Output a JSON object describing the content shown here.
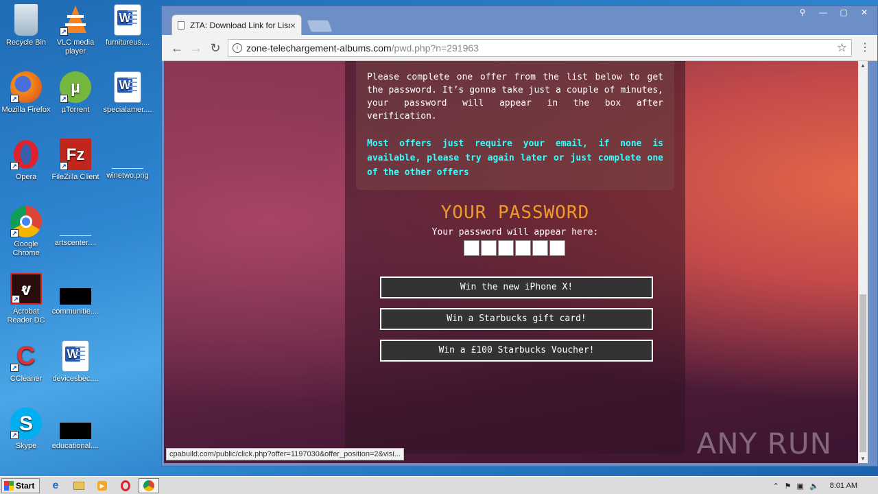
{
  "desktop": {
    "icons": [
      {
        "label": "Recycle Bin",
        "icon": "recycle-bin-icon"
      },
      {
        "label": "VLC media player",
        "icon": "vlc-icon"
      },
      {
        "label": "furnitureus....",
        "icon": "word-doc-icon"
      },
      {
        "label": "Mozilla Firefox",
        "icon": "firefox-icon"
      },
      {
        "label": "µTorrent",
        "icon": "utorrent-icon"
      },
      {
        "label": "specialamer....",
        "icon": "word-doc-icon"
      },
      {
        "label": "Opera",
        "icon": "opera-icon"
      },
      {
        "label": "FileZilla Client",
        "icon": "filezilla-icon"
      },
      {
        "label": "winetwo.png",
        "icon": "image-file-icon"
      },
      {
        "label": "Google Chrome",
        "icon": "chrome-icon"
      },
      {
        "label": "artscenter....",
        "icon": "image-file-icon"
      },
      {
        "label": "Acrobat Reader DC",
        "icon": "acrobat-icon"
      },
      {
        "label": "communitie....",
        "icon": "image-file-icon"
      },
      {
        "label": "CCleaner",
        "icon": "ccleaner-icon"
      },
      {
        "label": "devicesbec....",
        "icon": "word-doc-icon"
      },
      {
        "label": "Skype",
        "icon": "skype-icon"
      },
      {
        "label": "educational....",
        "icon": "image-file-icon"
      }
    ]
  },
  "browser": {
    "tab_title": "ZTA: Download Link for Lisa",
    "url_host": "zone-telechargement-albums.com",
    "url_path": "/pwd.php?n=291963",
    "status_url": "cpabuild.com/public/click.php?offer=1197030&offer_position=2&visi..."
  },
  "page": {
    "intro": "Please complete one offer from the list below to get the password. It’s gonna take just a couple of minutes, your password will appear in the box after verification.",
    "notice": "Most offers just require your email, if none is available, please try again later or just complete one of the other offers",
    "password_title": "YOUR PASSWORD",
    "password_sub": "Your password will appear here:",
    "offers": [
      "Win the new iPhone X!",
      "Win a Starbucks gift card!",
      "Win a £100 Starbucks Voucher!"
    ],
    "watermark": "ANY RUN"
  },
  "taskbar": {
    "start_label": "Start",
    "clock": "8:01 AM"
  },
  "colors": {
    "password_title": "#f09a28",
    "notice": "#33ffff",
    "desktop_bg": "#2f86d1"
  }
}
